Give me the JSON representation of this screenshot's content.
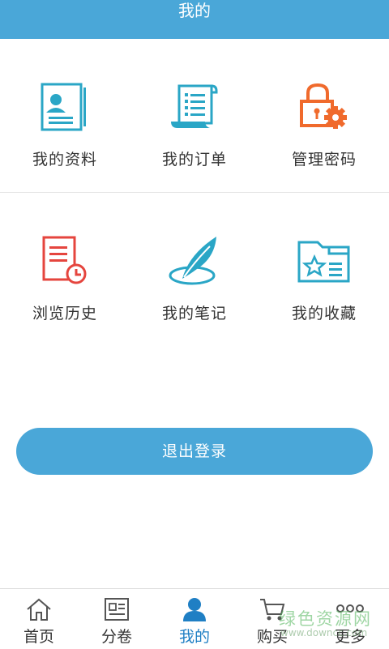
{
  "header": {
    "title": "我的"
  },
  "menu": {
    "rows": [
      [
        {
          "label": "我的资料",
          "icon": "profile-card-icon"
        },
        {
          "label": "我的订单",
          "icon": "order-scroll-icon"
        },
        {
          "label": "管理密码",
          "icon": "lock-gear-icon"
        }
      ],
      [
        {
          "label": "浏览历史",
          "icon": "history-document-icon"
        },
        {
          "label": "我的笔记",
          "icon": "feather-note-icon"
        },
        {
          "label": "我的收藏",
          "icon": "favorite-folder-icon"
        }
      ]
    ]
  },
  "logout": {
    "label": "退出登录"
  },
  "tabbar": {
    "items": [
      {
        "label": "首页",
        "icon": "home-icon"
      },
      {
        "label": "分卷",
        "icon": "volume-icon"
      },
      {
        "label": "我的",
        "icon": "user-icon",
        "active": true
      },
      {
        "label": "购买",
        "icon": "cart-icon"
      },
      {
        "label": "更多",
        "icon": "more-icon"
      }
    ]
  },
  "watermark": {
    "cn": "绿色资源网",
    "en": "www.downcc.com"
  },
  "colors": {
    "accent": "#4aa7d8",
    "teal": "#2aa6c6",
    "orange": "#f06a2c",
    "red": "#e5453e",
    "active_tab": "#1f7fc4"
  }
}
